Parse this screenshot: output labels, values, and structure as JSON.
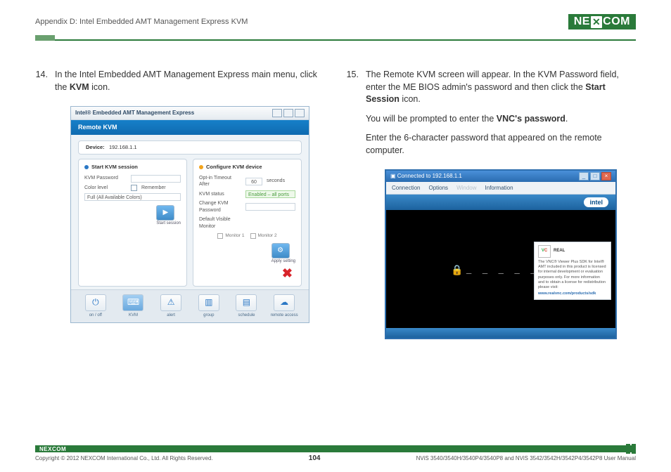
{
  "header": {
    "title": "Appendix D: Intel Embedded AMT Management Express KVM",
    "logo": "NEXCOM"
  },
  "step14": {
    "num": "14.",
    "text_a": "In the Intel Embedded AMT Management Express main menu, click the ",
    "text_b": "KVM",
    "text_c": " icon."
  },
  "shot1": {
    "title": "Intel® Embedded AMT Management Express",
    "section": "Remote KVM",
    "device_label": "Device:",
    "device_ip": "192.168.1.1",
    "left": {
      "heading": "Start KVM session",
      "row1": "KVM Password",
      "row2": "Color level",
      "remember": "Remember",
      "row3": "Full (All Available Colors)",
      "btn": "Start session"
    },
    "right": {
      "heading": "Configure KVM device",
      "r1a": "Opt-in Timeout After",
      "r1b": "60",
      "r1c": "seconds",
      "r2a": "KVM status",
      "r2b": "Enabled – all ports",
      "r3": "Change KVM Password",
      "r4": "Default Visible Monitor",
      "m1": "Monitor 1",
      "m2": "Monitor 2",
      "btn": "Apply setting"
    },
    "tabs": [
      "on / off",
      "KVM",
      "alert",
      "group",
      "schedule",
      "remote access"
    ]
  },
  "step15": {
    "num": "15.",
    "p1a": "The Remote KVM screen will appear. In the KVM Password field, enter the ME BIOS admin's password and then click the ",
    "p1b": "Start Session",
    "p1c": " icon.",
    "p2a": "You will be prompted to enter the ",
    "p2b": "VNC's password",
    "p2c": ".",
    "p3": "Enter the 6-character password that appeared on the remote computer."
  },
  "shot2": {
    "title": "Connected to 192.168.1.1",
    "menu": {
      "m1": "Connection",
      "m2": "Options",
      "m3": "Window",
      "m4": "Information"
    },
    "intel": "intel",
    "pw": "_ _ _ _ _ _",
    "vnc": {
      "logo1": "REAL",
      "logo2": "V",
      "logo3": "C",
      "txt": "The VNC® Viewer Plus SDK for Intel® AMT included in this product is licensed for internal development or evaluation purposes only. For more information and to obtain a license for redistribution please visit:",
      "url": "www.realvnc.com/products/sdk"
    }
  },
  "footer": {
    "copyright": "Copyright © 2012 NEXCOM International Co., Ltd. All Rights Reserved.",
    "page": "104",
    "doc": "NViS 3540/3540H/3540P4/3540P8 and NViS 3542/3542H/3542P4/3542P8 User Manual",
    "logo": "NEXCOM"
  }
}
